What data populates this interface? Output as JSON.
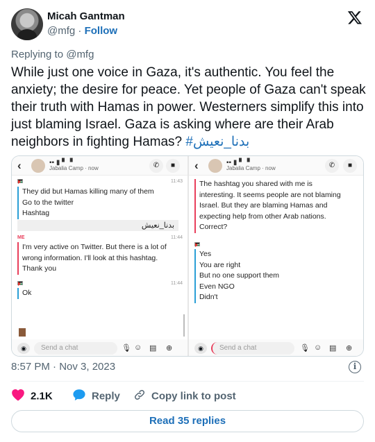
{
  "author": {
    "name": "Micah Gantman",
    "handle": "@mfg",
    "separator": " · ",
    "follow_label": "Follow"
  },
  "reply_to": "Replying to @mfg",
  "tweet": {
    "text": "While just one voice in Gaza, it's authentic. You feel the anxiety; the desire for peace. Yet people of Gaza can't speak their truth with Hamas in power. Westerners simplify this into just blaming Israel. Gaza is asking where are their Arab neighbors in fighting Hamas? ",
    "hashtag": "#بدنا_نعيش"
  },
  "media": {
    "left": {
      "contact": "Jabalia Camp",
      "status": "· now",
      "messages": [
        {
          "time": "11:43",
          "lines": [
            "They did but Hamas killing many of them",
            "Go to the twitter",
            "Hashtag"
          ]
        },
        {
          "arabic": "بدنا_نعيش"
        },
        {
          "sender": "ME",
          "time": "11:44",
          "lines": [
            "I'm very active on Twitter. But there is a lot of",
            "wrong information. I'll look at this hashtag.",
            "Thank you"
          ]
        },
        {
          "time": "11:44",
          "lines": [
            "Ok"
          ]
        }
      ],
      "input_placeholder": "Send a chat"
    },
    "right": {
      "contact": "Jabalia Camp",
      "status": "· now",
      "messages": [
        {
          "lines": [
            "The hashtag you shared with me is",
            "interesting. It seems people are not blaming",
            "Israel. But they are blaming Hamas and",
            "expecting help from other Arab nations.",
            "Correct?"
          ]
        },
        {
          "lines": [
            "Yes",
            "You are right",
            "But no one support them",
            "Even NGO",
            "Didn't"
          ]
        }
      ],
      "input_placeholder": "Send a chat"
    }
  },
  "timestamp": "8:57 PM · Nov 3, 2023",
  "actions": {
    "like_count": "2.1K",
    "reply_label": "Reply",
    "copy_label": "Copy link to post"
  },
  "read_replies_label": "Read 35 replies",
  "colors": {
    "link": "#1d6fb8",
    "like": "#f91880",
    "muted": "#536471"
  }
}
